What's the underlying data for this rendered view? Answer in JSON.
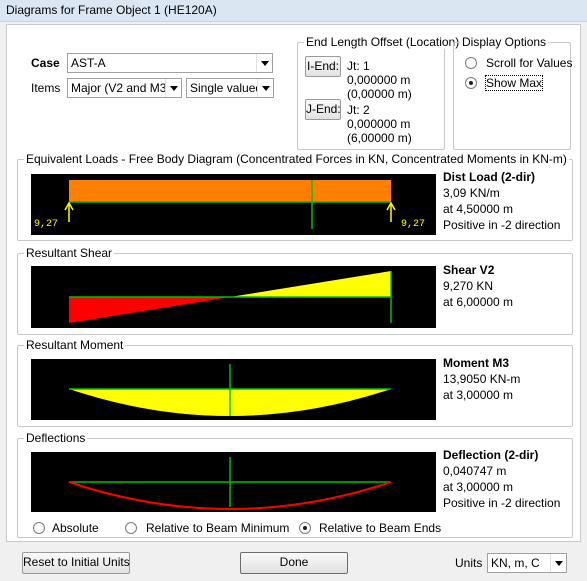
{
  "window": {
    "title": "Diagrams for Frame Object 1  (HE120A)"
  },
  "case": {
    "label": "Case",
    "value": "AST-A"
  },
  "items": {
    "label": "Items",
    "component": "Major (V2 and M3)",
    "mode": "Single valued"
  },
  "end_offset": {
    "title": "End Length Offset (Location)",
    "i_end": {
      "button": "I-End:",
      "jt": "Jt:  1",
      "offset": "0,000000 m",
      "location": "(0,00000 m)"
    },
    "j_end": {
      "button": "J-End:",
      "jt": "Jt:  2",
      "offset": "0,000000 m",
      "location": "(6,00000 m)"
    }
  },
  "display_options": {
    "title": "Display Options",
    "scroll": "Scroll for Values",
    "show_max": "Show Max",
    "selected": "show_max"
  },
  "equivalent_loads": {
    "title": "Equivalent Loads - Free Body Diagram  (Concentrated Forces in KN, Concentrated Moments in KN-m)",
    "left_reaction": "9,27",
    "right_reaction": "9,27",
    "heading": "Dist Load (2-dir)",
    "line1": "3,09 KN/m",
    "line2": "at 4,50000 m",
    "line3": "Positive in -2 direction",
    "color": "#ff8000"
  },
  "shear": {
    "title": "Resultant Shear",
    "heading": "Shear V2",
    "line1": "9,270 KN",
    "line2": "at 6,00000 m",
    "color_pos": "#ffff00",
    "color_neg": "#ff0000"
  },
  "moment": {
    "title": "Resultant Moment",
    "heading": "Moment M3",
    "line1": "13,9050 KN-m",
    "line2": "at 3,00000 m",
    "color": "#ffff00"
  },
  "deflection": {
    "title": "Deflections",
    "heading": "Deflection (2-dir)",
    "line1": "0,040747 m",
    "line2": "at 3,00000 m",
    "line3": "Positive in -2 direction",
    "color": "#ff0000",
    "options": [
      "Absolute",
      "Relative to Beam Minimum",
      "Relative to Beam Ends"
    ],
    "selected_index": 2
  },
  "footer": {
    "reset": "Reset to Initial Units",
    "done": "Done",
    "units_label": "Units",
    "units_value": "KN, m, C"
  }
}
